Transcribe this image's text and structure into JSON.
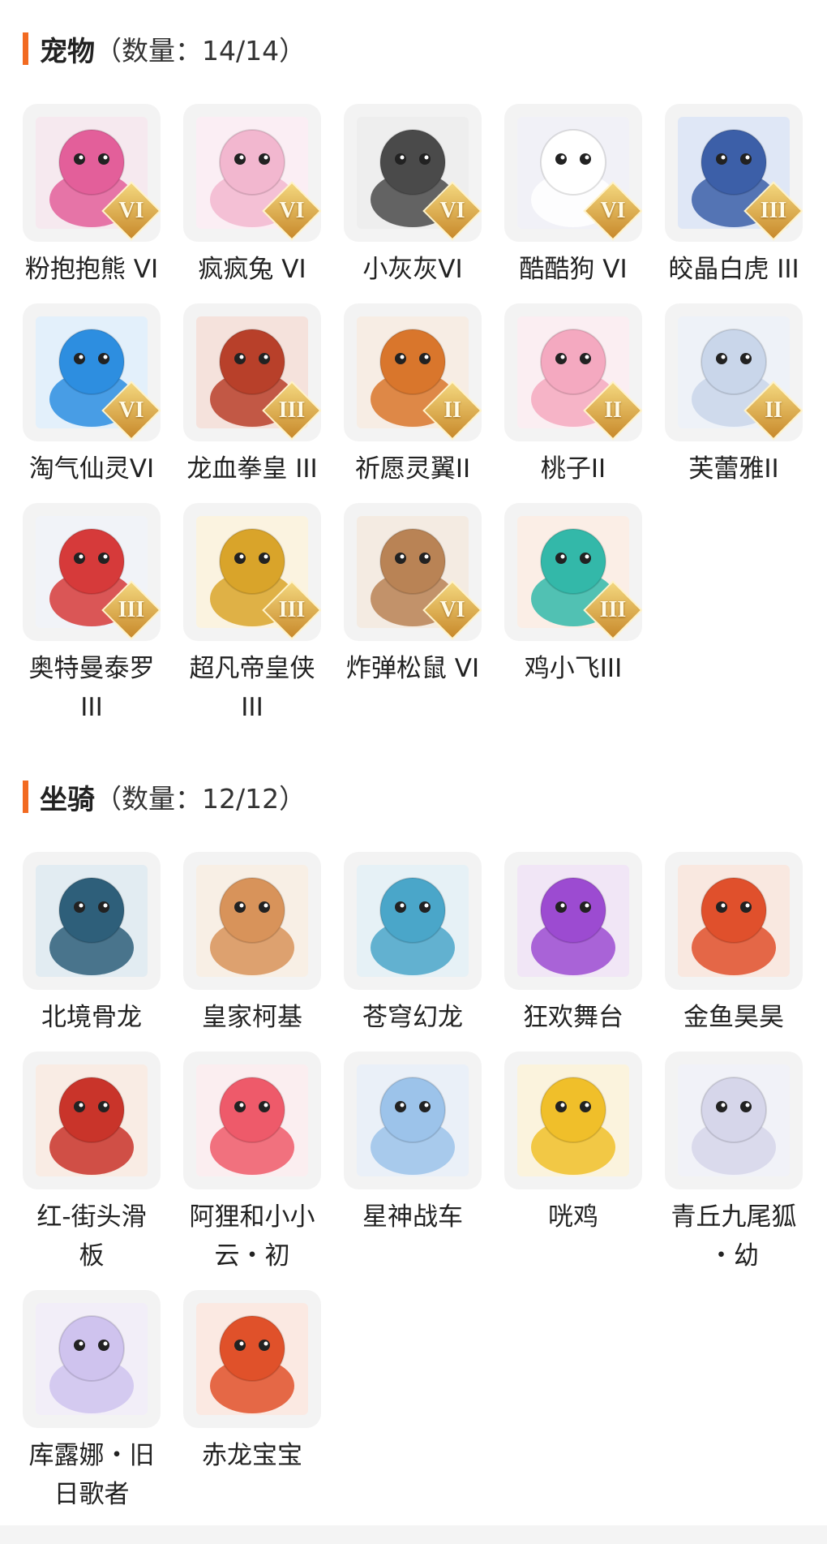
{
  "pets": {
    "title": "宠物",
    "count": "（数量：14/14）",
    "items": [
      {
        "name": "粉抱抱熊 VI",
        "badge": "VI",
        "bg": "#f6e9ef",
        "color": "#e35f9a",
        "icon": "bear-pet-icon"
      },
      {
        "name": "疯疯兔 VI",
        "badge": "VI",
        "bg": "#fbeef4",
        "color": "#f2b7cf",
        "icon": "rabbit-pet-icon"
      },
      {
        "name": "小灰灰VI",
        "badge": "VI",
        "bg": "#eeeeee",
        "color": "#4a4a4a",
        "icon": "grey-wolf-pet-icon"
      },
      {
        "name": "酷酷狗 VI",
        "badge": "VI",
        "bg": "#f1f1f7",
        "color": "#ffffff",
        "icon": "goggles-dog-pet-icon"
      },
      {
        "name": "皎晶白虎 III",
        "badge": "III",
        "bg": "#dfe7f6",
        "color": "#3c5fa8",
        "icon": "white-tiger-pet-icon"
      },
      {
        "name": "淘气仙灵VI",
        "badge": "VI",
        "bg": "#e3f0fb",
        "color": "#2d8ee0",
        "icon": "blue-puppy-pet-icon"
      },
      {
        "name": "龙血拳皇 III",
        "badge": "III",
        "bg": "#f5e2dc",
        "color": "#b8402a",
        "icon": "dragon-fist-pet-icon"
      },
      {
        "name": "祈愿灵翼II",
        "badge": "II",
        "bg": "#f7ede4",
        "color": "#d9762c",
        "icon": "eagle-pet-icon"
      },
      {
        "name": "桃子II",
        "badge": "II",
        "bg": "#fbeef2",
        "color": "#f4a9c0",
        "icon": "peach-cat-pet-icon"
      },
      {
        "name": "芙蕾雅II",
        "badge": "II",
        "bg": "#eef2f8",
        "color": "#c9d6ea",
        "icon": "freya-pet-icon"
      },
      {
        "name": "奥特曼泰罗\nIII",
        "badge": "III",
        "bg": "#f1f3f8",
        "color": "#d63a3a",
        "icon": "ultraman-pet-icon"
      },
      {
        "name": "超凡帝皇侠\nIII",
        "badge": "III",
        "bg": "#fbf3e0",
        "color": "#d9a42a",
        "icon": "emperor-hero-pet-icon"
      },
      {
        "name": "炸弹松鼠 VI",
        "badge": "VI",
        "bg": "#f4ebe2",
        "color": "#b98355",
        "icon": "squirrel-pet-icon"
      },
      {
        "name": "鸡小飞III",
        "badge": "III",
        "bg": "#fbeee6",
        "color": "#33b8a9",
        "icon": "chick-pet-icon"
      }
    ]
  },
  "mounts": {
    "title": "坐骑",
    "count": "（数量：12/12）",
    "items": [
      {
        "name": "北境骨龙",
        "bg": "#e2ecf2",
        "color": "#2e5f7a",
        "icon": "bone-dragon-mount-icon"
      },
      {
        "name": "皇家柯基",
        "bg": "#f8efe5",
        "color": "#d8935a",
        "icon": "corgi-mount-icon"
      },
      {
        "name": "苍穹幻龙",
        "bg": "#e6f1f6",
        "color": "#4aa6c9",
        "icon": "sky-dragon-mount-icon"
      },
      {
        "name": "狂欢舞台",
        "bg": "#f1e6f6",
        "color": "#9c4bd1",
        "icon": "carnival-stage-mount-icon"
      },
      {
        "name": "金鱼昊昊",
        "bg": "#f9e8e0",
        "color": "#e0502c",
        "icon": "goldfish-mount-icon"
      },
      {
        "name": "红-街头滑\n板",
        "bg": "#f9ece4",
        "color": "#c9342a",
        "icon": "skateboard-mount-icon"
      },
      {
        "name": "阿狸和小小\n云・初",
        "bg": "#fbeef0",
        "color": "#ee5a6a",
        "icon": "ali-cloud-mount-icon"
      },
      {
        "name": "星神战车",
        "bg": "#eaf0f8",
        "color": "#9cc3ea",
        "icon": "star-chariot-mount-icon"
      },
      {
        "name": "咣鸡",
        "bg": "#fbf3dd",
        "color": "#f0bf2a",
        "icon": "rooster-mount-icon"
      },
      {
        "name": "青丘九尾狐\n・幼",
        "bg": "#f1f2f8",
        "color": "#d6d6ea",
        "icon": "nine-tail-fox-mount-icon"
      },
      {
        "name": "库露娜・旧\n日歌者",
        "bg": "#f2eef8",
        "color": "#cfc3ee",
        "icon": "kuluna-mount-icon"
      },
      {
        "name": "赤龙宝宝",
        "bg": "#fbe9e2",
        "color": "#e0512a",
        "icon": "baby-red-dragon-mount-icon"
      }
    ]
  }
}
